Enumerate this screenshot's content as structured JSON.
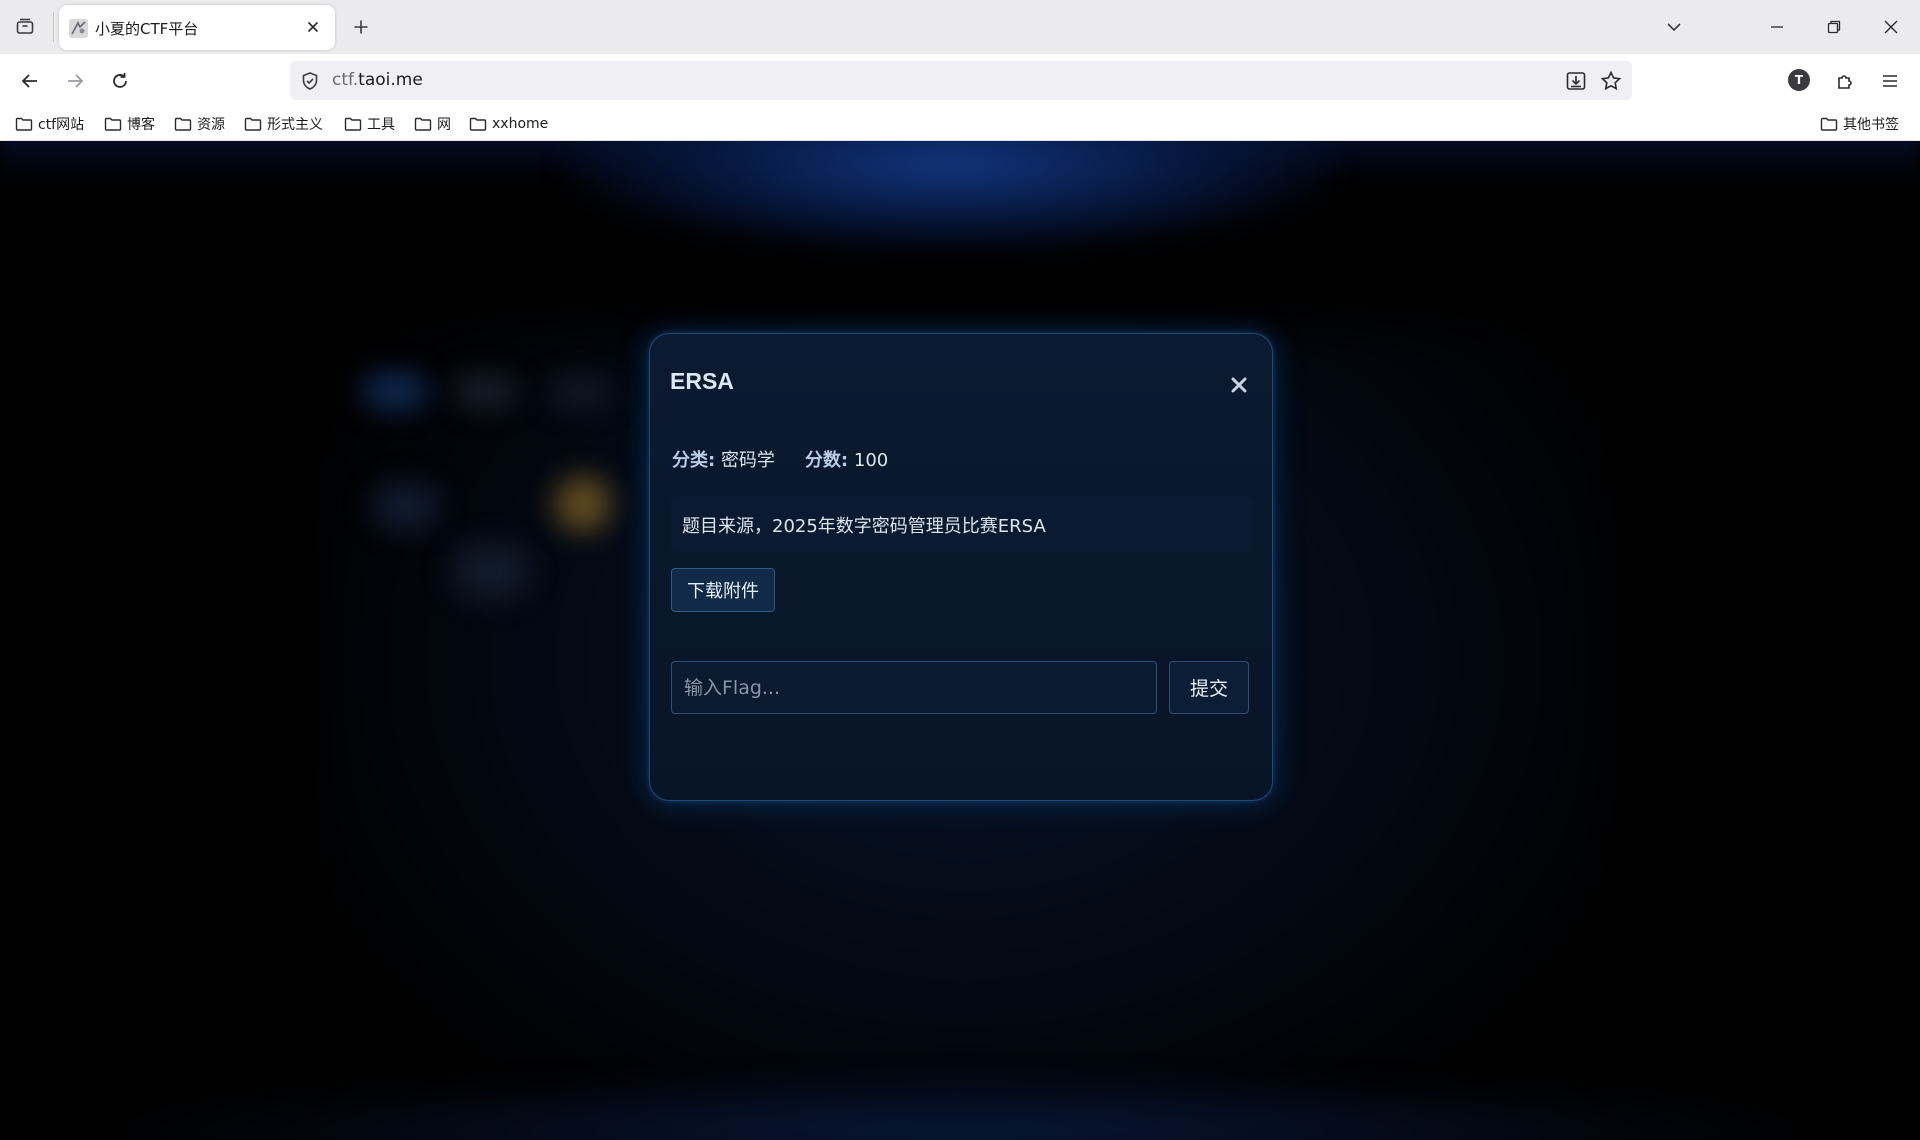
{
  "browser": {
    "tab": {
      "title": "小夏的CTF平台"
    },
    "url": {
      "prefix": "ctf.",
      "domain": "taoi.me"
    },
    "profile_initial": "T",
    "bookmarks": [
      {
        "label": "ctf网站"
      },
      {
        "label": "博客"
      },
      {
        "label": "资源"
      },
      {
        "label": "形式主义"
      },
      {
        "label": "工具"
      },
      {
        "label": "网"
      },
      {
        "label": "xxhome"
      }
    ],
    "other_bookmarks": "其他书签"
  },
  "modal": {
    "title": "ERSA",
    "category_label": "分类:",
    "category_value": "密码学",
    "score_label": "分数:",
    "score_value": "100",
    "description": "题目来源，2025年数字密码管理员比赛ERSA",
    "download_label": "下载附件",
    "flag_placeholder": "输入Flag...",
    "submit_label": "提交"
  },
  "colors": {
    "modal_bg": "#0b1a30",
    "modal_border": "#1d4a78",
    "accent_glow": "#1e6ec8"
  }
}
